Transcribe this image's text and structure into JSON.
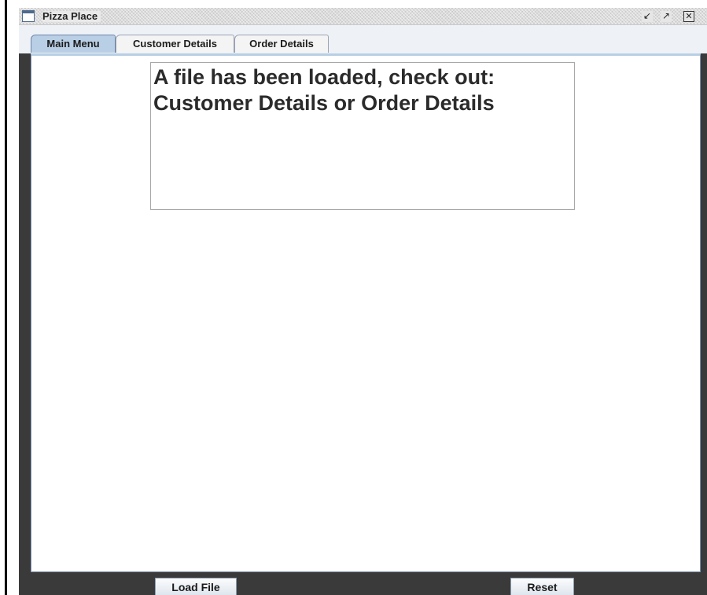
{
  "window": {
    "title": "Pizza Place",
    "icon": "app-window-icon",
    "controls": {
      "minimize": "minimize-icon",
      "maximize": "maximize-icon",
      "close": "close-icon"
    }
  },
  "tabs": [
    {
      "label": "Main Menu",
      "selected": true
    },
    {
      "label": "Customer Details",
      "selected": false
    },
    {
      "label": "Order Details",
      "selected": false
    }
  ],
  "main": {
    "message_line1": "A file has been loaded, check out:",
    "message_line2": "Customer Details or Order Details"
  },
  "buttons": {
    "load_file": "Load File",
    "reset": "Reset"
  },
  "colors": {
    "selected_tab": "#b8cfe5",
    "window_background": "#3a3a3a",
    "content_border": "#7f93b3"
  }
}
